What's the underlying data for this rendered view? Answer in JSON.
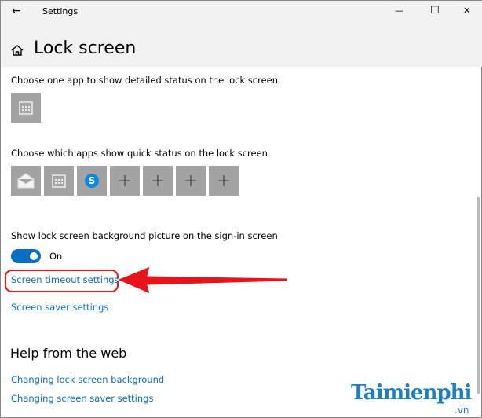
{
  "window": {
    "title": "Settings",
    "back": "←",
    "minimize": "—",
    "maximize": "☐",
    "close": "✕"
  },
  "page": {
    "title": "Lock screen"
  },
  "detailed": {
    "label": "Choose one app to show detailed status on the lock screen",
    "apps": [
      "calendar"
    ]
  },
  "quick": {
    "label": "Choose which apps show quick status on the lock screen",
    "apps": [
      "mail",
      "calendar",
      "skype",
      "add",
      "add",
      "add",
      "add"
    ],
    "plus": "+",
    "skype_letter": "S"
  },
  "background": {
    "label": "Show lock screen background picture on the sign-in screen",
    "toggle_state": "On",
    "enabled": true
  },
  "links": {
    "timeout": "Screen timeout settings",
    "saver": "Screen saver settings"
  },
  "help": {
    "title": "Help from the web",
    "links": [
      "Changing lock screen background",
      "Changing screen saver settings"
    ]
  },
  "watermark": {
    "name": "Taimienphi",
    "suffix": ".vn"
  },
  "colors": {
    "accent": "#0a6fc2",
    "annotation": "#e8141c"
  }
}
